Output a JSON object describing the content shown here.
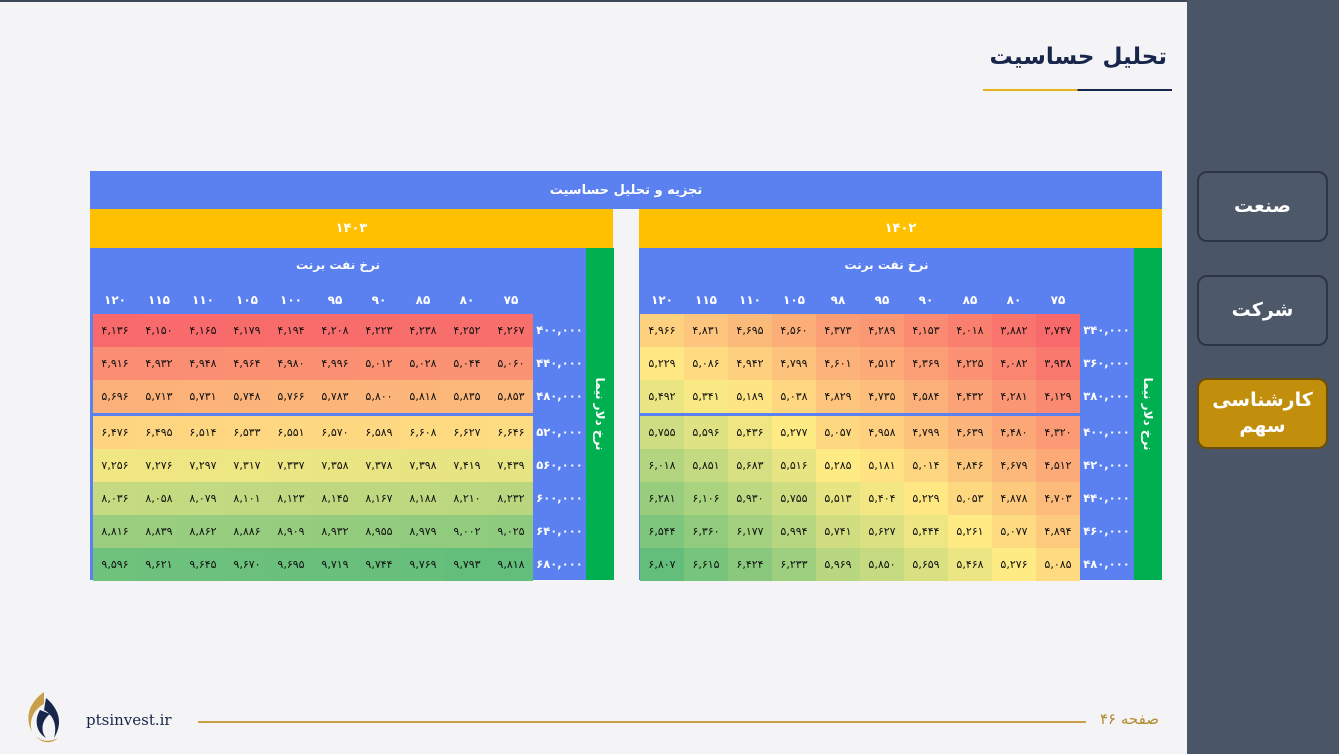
{
  "page_title": "تحلیل حساسیت",
  "nav": [
    {
      "label": "صنعت",
      "active": false
    },
    {
      "label": "شرکت",
      "active": false
    },
    {
      "label": "کارشناسی سهم",
      "active": true
    }
  ],
  "table": {
    "header": "تجزیه و تحلیل حساسیت",
    "oil_label": "نرخ نفت برنت",
    "dollar_label": "نرخ دلار نیما",
    "left": {
      "year": "۱۴۰۳",
      "oil_prices": [
        "۷۵",
        "۸۰",
        "۸۵",
        "۹۰",
        "۹۵",
        "۱۰۰",
        "۱۰۵",
        "۱۱۰",
        "۱۱۵",
        "۱۲۰"
      ],
      "rows": [
        {
          "label": "۴۰۰,۰۰۰",
          "values": [
            "۴,۲۶۷",
            "۴,۲۵۲",
            "۴,۲۳۸",
            "۴,۲۲۳",
            "۴,۲۰۸",
            "۴,۱۹۴",
            "۴,۱۷۹",
            "۴,۱۶۵",
            "۴,۱۵۰",
            "۴,۱۳۶"
          ]
        },
        {
          "label": "۴۴۰,۰۰۰",
          "values": [
            "۵,۰۶۰",
            "۵,۰۴۴",
            "۵,۰۲۸",
            "۵,۰۱۲",
            "۴,۹۹۶",
            "۴,۹۸۰",
            "۴,۹۶۴",
            "۴,۹۴۸",
            "۴,۹۳۲",
            "۴,۹۱۶"
          ]
        },
        {
          "label": "۴۸۰,۰۰۰",
          "values": [
            "۵,۸۵۳",
            "۵,۸۳۵",
            "۵,۸۱۸",
            "۵,۸۰۰",
            "۵,۷۸۳",
            "۵,۷۶۶",
            "۵,۷۴۸",
            "۵,۷۳۱",
            "۵,۷۱۳",
            "۵,۶۹۶"
          ]
        },
        {
          "label": "۵۲۰,۰۰۰",
          "values": [
            "۶,۶۴۶",
            "۶,۶۲۷",
            "۶,۶۰۸",
            "۶,۵۸۹",
            "۶,۵۷۰",
            "۶,۵۵۱",
            "۶,۵۳۳",
            "۶,۵۱۴",
            "۶,۴۹۵",
            "۶,۴۷۶"
          ]
        },
        {
          "label": "۵۶۰,۰۰۰",
          "values": [
            "۷,۴۳۹",
            "۷,۴۱۹",
            "۷,۳۹۸",
            "۷,۳۷۸",
            "۷,۳۵۸",
            "۷,۳۳۷",
            "۷,۳۱۷",
            "۷,۲۹۷",
            "۷,۲۷۶",
            "۷,۲۵۶"
          ]
        },
        {
          "label": "۶۰۰,۰۰۰",
          "values": [
            "۸,۲۳۲",
            "۸,۲۱۰",
            "۸,۱۸۸",
            "۸,۱۶۷",
            "۸,۱۴۵",
            "۸,۱۲۳",
            "۸,۱۰۱",
            "۸,۰۷۹",
            "۸,۰۵۸",
            "۸,۰۳۶"
          ]
        },
        {
          "label": "۶۴۰,۰۰۰",
          "values": [
            "۹,۰۲۵",
            "۹,۰۰۲",
            "۸,۹۷۹",
            "۸,۹۵۵",
            "۸,۹۳۲",
            "۸,۹۰۹",
            "۸,۸۸۶",
            "۸,۸۶۲",
            "۸,۸۳۹",
            "۸,۸۱۶"
          ]
        },
        {
          "label": "۶۸۰,۰۰۰",
          "values": [
            "۹,۸۱۸",
            "۹,۷۹۳",
            "۹,۷۶۹",
            "۹,۷۴۴",
            "۹,۷۱۹",
            "۹,۶۹۵",
            "۹,۶۷۰",
            "۹,۶۴۵",
            "۹,۶۲۱",
            "۹,۵۹۶"
          ]
        }
      ]
    },
    "right": {
      "year": "۱۴۰۲",
      "oil_prices": [
        "۷۵",
        "۸۰",
        "۸۵",
        "۹۰",
        "۹۵",
        "۹۸",
        "۱۰۵",
        "۱۱۰",
        "۱۱۵",
        "۱۲۰"
      ],
      "rows": [
        {
          "label": "۳۴۰,۰۰۰",
          "values": [
            "۳,۷۴۷",
            "۳,۸۸۲",
            "۴,۰۱۸",
            "۴,۱۵۳",
            "۴,۲۸۹",
            "۴,۳۷۳",
            "۴,۵۶۰",
            "۴,۶۹۵",
            "۴,۸۳۱",
            "۴,۹۶۶"
          ]
        },
        {
          "label": "۳۶۰,۰۰۰",
          "values": [
            "۳,۹۳۸",
            "۴,۰۸۲",
            "۴,۲۲۵",
            "۴,۳۶۹",
            "۴,۵۱۲",
            "۴,۶۰۱",
            "۴,۷۹۹",
            "۴,۹۴۲",
            "۵,۰۸۶",
            "۵,۲۲۹"
          ]
        },
        {
          "label": "۳۸۰,۰۰۰",
          "values": [
            "۴,۱۲۹",
            "۴,۲۸۱",
            "۴,۴۳۲",
            "۴,۵۸۴",
            "۴,۷۳۵",
            "۴,۸۲۹",
            "۵,۰۳۸",
            "۵,۱۸۹",
            "۵,۳۴۱",
            "۵,۴۹۲"
          ]
        },
        {
          "label": "۴۰۰,۰۰۰",
          "values": [
            "۴,۳۲۰",
            "۴,۴۸۰",
            "۴,۶۳۹",
            "۴,۷۹۹",
            "۴,۹۵۸",
            "۵,۰۵۷",
            "۵,۲۷۷",
            "۵,۴۳۶",
            "۵,۵۹۶",
            "۵,۷۵۵"
          ]
        },
        {
          "label": "۴۲۰,۰۰۰",
          "values": [
            "۴,۵۱۲",
            "۴,۶۷۹",
            "۴,۸۴۶",
            "۵,۰۱۴",
            "۵,۱۸۱",
            "۵,۲۸۵",
            "۵,۵۱۶",
            "۵,۶۸۳",
            "۵,۸۵۱",
            "۶,۰۱۸"
          ]
        },
        {
          "label": "۴۴۰,۰۰۰",
          "values": [
            "۴,۷۰۳",
            "۴,۸۷۸",
            "۵,۰۵۳",
            "۵,۲۲۹",
            "۵,۴۰۴",
            "۵,۵۱۳",
            "۵,۷۵۵",
            "۵,۹۳۰",
            "۶,۱۰۶",
            "۶,۲۸۱"
          ]
        },
        {
          "label": "۴۶۰,۰۰۰",
          "values": [
            "۴,۸۹۴",
            "۵,۰۷۷",
            "۵,۲۶۱",
            "۵,۴۴۴",
            "۵,۶۲۷",
            "۵,۷۴۱",
            "۵,۹۹۴",
            "۶,۱۷۷",
            "۶,۳۶۰",
            "۶,۵۴۴"
          ]
        },
        {
          "label": "۴۸۰,۰۰۰",
          "values": [
            "۵,۰۸۵",
            "۵,۲۷۶",
            "۵,۴۶۸",
            "۵,۶۵۹",
            "۵,۸۵۰",
            "۵,۹۶۹",
            "۶,۲۳۳",
            "۶,۴۲۴",
            "۶,۶۱۵",
            "۶,۸۰۷"
          ]
        }
      ]
    }
  },
  "footer": {
    "page": "صفحه ۴۶",
    "site": "ptsinvest.ir"
  }
}
